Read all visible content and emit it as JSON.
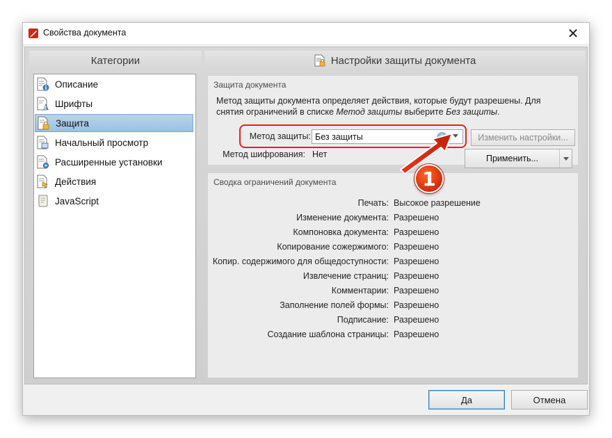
{
  "window": {
    "title": "Свойства документа",
    "close_glyph": "✕"
  },
  "categories": {
    "header": "Категории",
    "items": [
      {
        "label": "Описание",
        "icon": "document-info-icon",
        "selected": false
      },
      {
        "label": "Шрифты",
        "icon": "document-font-icon",
        "selected": false
      },
      {
        "label": "Защита",
        "icon": "document-lock-icon",
        "selected": true
      },
      {
        "label": "Начальный просмотр",
        "icon": "document-view-icon",
        "selected": false
      },
      {
        "label": "Расширенные установки",
        "icon": "document-gear-icon",
        "selected": false
      },
      {
        "label": "Действия",
        "icon": "document-action-icon",
        "selected": false
      },
      {
        "label": "JavaScript",
        "icon": "script-scroll-icon",
        "selected": false
      }
    ]
  },
  "protection": {
    "header": "Настройки защиты документа",
    "group_title": "Защита документа",
    "description_part1": "Метод защиты документа определяет действия, которые будут разрешены. Для снятия ограничений в списке ",
    "description_em1": "Метод защиты",
    "description_part2": " выберите ",
    "description_em2": "Без защиты",
    "description_part3": ".",
    "method_label": "Метод защиты:",
    "method_value": "Без защиты",
    "encryption_label": "Метод шифрования:",
    "encryption_value": "Нет",
    "change_settings_button": "Изменить настройки...",
    "apply_button": "Применить..."
  },
  "summary": {
    "group_title": "Сводка ограничений документа",
    "rows": [
      {
        "key": "Печать:",
        "value": "Высокое разрешение"
      },
      {
        "key": "Изменение документа:",
        "value": "Разрешено"
      },
      {
        "key": "Компоновка документа:",
        "value": "Разрешено"
      },
      {
        "key": "Копирование сожержимого:",
        "value": "Разрешено"
      },
      {
        "key": "Копир. содержимого для общедоступности:",
        "value": "Разрешено"
      },
      {
        "key": "Извлечение страниц:",
        "value": "Разрешено"
      },
      {
        "key": "Комментарии:",
        "value": "Разрешено"
      },
      {
        "key": "Заполнение полей формы:",
        "value": "Разрешено"
      },
      {
        "key": "Подписание:",
        "value": "Разрешено"
      },
      {
        "key": "Создание шаблона страницы:",
        "value": "Разрешено"
      }
    ]
  },
  "footer": {
    "ok_button": "Да",
    "cancel_button": "Отмена"
  },
  "annotation": {
    "badge_number": "1",
    "color": "#d8271e"
  }
}
